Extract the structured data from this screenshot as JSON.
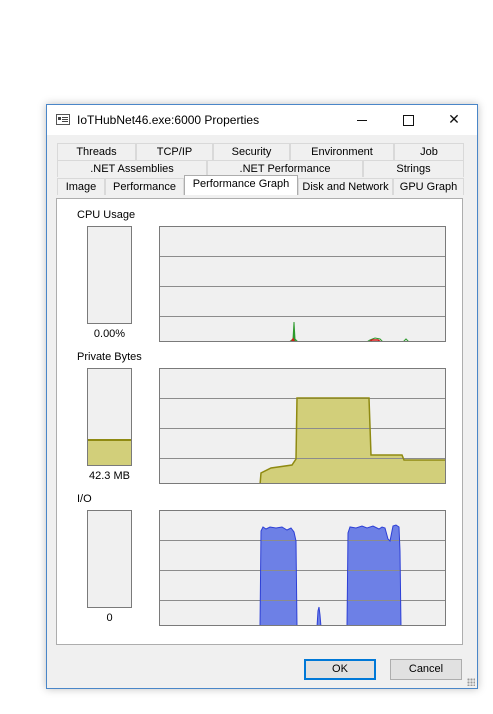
{
  "window": {
    "title": "IoTHubNet46.exe:6000 Properties"
  },
  "tabs": {
    "row1": [
      "Threads",
      "TCP/IP",
      "Security",
      "Environment",
      "Job"
    ],
    "row2": [
      ".NET Assemblies",
      ".NET Performance",
      "Strings"
    ],
    "row3": [
      "Image",
      "Performance",
      "Performance Graph",
      "Disk and Network",
      "GPU Graph"
    ],
    "active": "Performance Graph"
  },
  "cpu": {
    "label": "CPU Usage",
    "value": "0.00%",
    "level": 0
  },
  "private_bytes": {
    "label": "Private Bytes",
    "value": "42.3 MB",
    "level": 0.27
  },
  "io": {
    "label": "I/O",
    "value": "0",
    "level": 0
  },
  "buttons": {
    "ok": "OK",
    "cancel": "Cancel"
  },
  "colors": {
    "cpu_kernel": "#d61a1a",
    "cpu_total": "#2c9a2c",
    "memory": "#d2cf7a",
    "memory_line": "#8f8a12",
    "io": "#6d80e6",
    "io_line": "#2d3fd6",
    "grid": "#8c8c8c"
  }
}
